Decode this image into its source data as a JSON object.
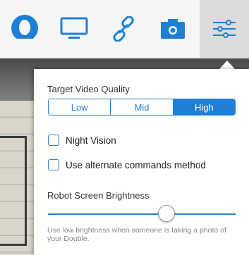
{
  "toolbar": {
    "items": [
      {
        "icon": "user-icon",
        "active": false
      },
      {
        "icon": "monitor-icon",
        "active": false
      },
      {
        "icon": "link-icon",
        "active": false
      },
      {
        "icon": "camera-icon",
        "active": false
      },
      {
        "icon": "settings-sliders-icon",
        "active": true
      }
    ],
    "accent_color": "#1e7fd6"
  },
  "settings": {
    "video_quality": {
      "title": "Target Video Quality",
      "options": [
        "Low",
        "Mid",
        "High"
      ],
      "selected": "High"
    },
    "night_vision": {
      "label": "Night Vision",
      "checked": false
    },
    "alternate_commands": {
      "label": "Use alternate commands method",
      "checked": false
    },
    "brightness": {
      "title": "Robot Screen Brightness",
      "level": 0.63,
      "hint": "Use low brightness when someone is taking a photo of your Double."
    }
  }
}
